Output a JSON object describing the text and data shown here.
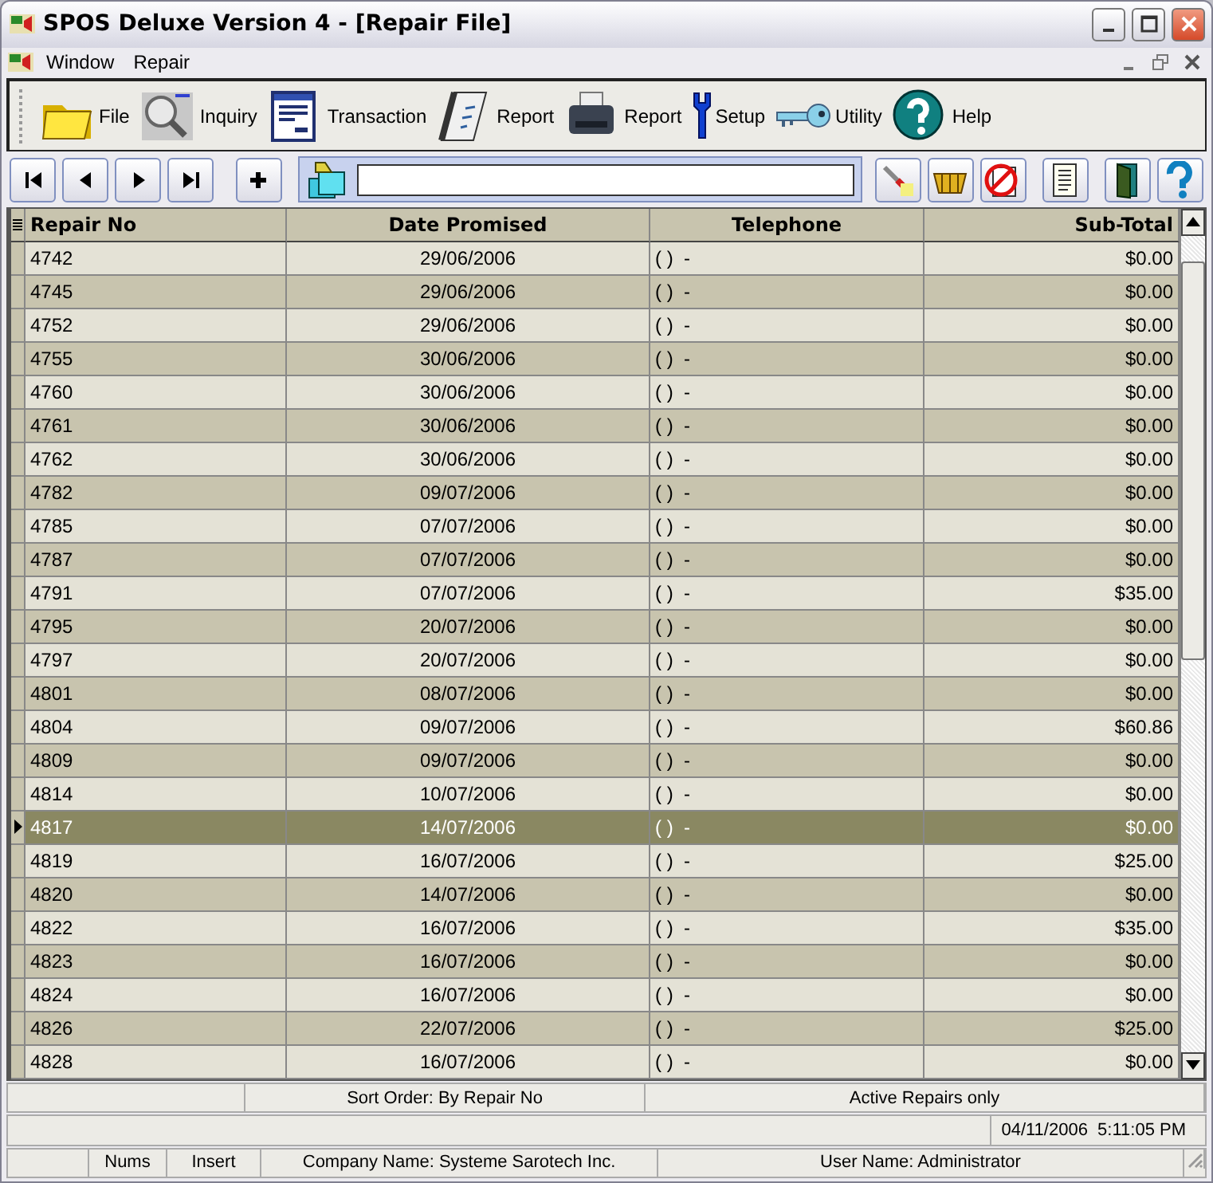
{
  "window": {
    "title": "SPOS Deluxe Version 4 - [Repair File]"
  },
  "menu": [
    "Window",
    "Repair"
  ],
  "toolbar": [
    {
      "kind": "folder",
      "label": "File"
    },
    {
      "kind": "magnifier",
      "label": "Inquiry"
    },
    {
      "kind": "form",
      "label": "Transaction"
    },
    {
      "kind": "notebook",
      "label": "Report"
    },
    {
      "kind": "printer",
      "label": "Report"
    },
    {
      "kind": "wrench",
      "label": "Setup"
    },
    {
      "kind": "key",
      "label": "Utility"
    },
    {
      "kind": "help",
      "label": "Help"
    }
  ],
  "table": {
    "columns": [
      "Repair No",
      "Date Promised",
      "Telephone",
      "Sub-Total"
    ],
    "rows": [
      {
        "cells": [
          "4742",
          "29/06/2006",
          "( )  -",
          "$0.00"
        ],
        "selected": false
      },
      {
        "cells": [
          "4745",
          "29/06/2006",
          "( )  -",
          "$0.00"
        ],
        "selected": false
      },
      {
        "cells": [
          "4752",
          "29/06/2006",
          "( )  -",
          "$0.00"
        ],
        "selected": false
      },
      {
        "cells": [
          "4755",
          "30/06/2006",
          "( )  -",
          "$0.00"
        ],
        "selected": false
      },
      {
        "cells": [
          "4760",
          "30/06/2006",
          "( )  -",
          "$0.00"
        ],
        "selected": false
      },
      {
        "cells": [
          "4761",
          "30/06/2006",
          "( )  -",
          "$0.00"
        ],
        "selected": false
      },
      {
        "cells": [
          "4762",
          "30/06/2006",
          "( )  -",
          "$0.00"
        ],
        "selected": false
      },
      {
        "cells": [
          "4782",
          "09/07/2006",
          "( )  -",
          "$0.00"
        ],
        "selected": false
      },
      {
        "cells": [
          "4785",
          "07/07/2006",
          "( )  -",
          "$0.00"
        ],
        "selected": false
      },
      {
        "cells": [
          "4787",
          "07/07/2006",
          "( )  -",
          "$0.00"
        ],
        "selected": false
      },
      {
        "cells": [
          "4791",
          "07/07/2006",
          "( )  -",
          "$35.00"
        ],
        "selected": false
      },
      {
        "cells": [
          "4795",
          "20/07/2006",
          "( )  -",
          "$0.00"
        ],
        "selected": false
      },
      {
        "cells": [
          "4797",
          "20/07/2006",
          "( )  -",
          "$0.00"
        ],
        "selected": false
      },
      {
        "cells": [
          "4801",
          "08/07/2006",
          "( )  -",
          "$0.00"
        ],
        "selected": false
      },
      {
        "cells": [
          "4804",
          "09/07/2006",
          "( )  -",
          "$60.86"
        ],
        "selected": false
      },
      {
        "cells": [
          "4809",
          "09/07/2006",
          "( )  -",
          "$0.00"
        ],
        "selected": false
      },
      {
        "cells": [
          "4814",
          "10/07/2006",
          "( )  -",
          "$0.00"
        ],
        "selected": false
      },
      {
        "cells": [
          "4817",
          "14/07/2006",
          "( )  -",
          "$0.00"
        ],
        "selected": true
      },
      {
        "cells": [
          "4819",
          "16/07/2006",
          "( )  -",
          "$25.00"
        ],
        "selected": false
      },
      {
        "cells": [
          "4820",
          "14/07/2006",
          "( )  -",
          "$0.00"
        ],
        "selected": false
      },
      {
        "cells": [
          "4822",
          "16/07/2006",
          "( )  -",
          "$35.00"
        ],
        "selected": false
      },
      {
        "cells": [
          "4823",
          "16/07/2006",
          "( )  -",
          "$0.00"
        ],
        "selected": false
      },
      {
        "cells": [
          "4824",
          "16/07/2006",
          "( )  -",
          "$0.00"
        ],
        "selected": false
      },
      {
        "cells": [
          "4826",
          "22/07/2006",
          "( )  -",
          "$25.00"
        ],
        "selected": false
      },
      {
        "cells": [
          "4828",
          "16/07/2006",
          "( )  -",
          "$0.00"
        ],
        "selected": false
      }
    ]
  },
  "status_bars": [
    {
      "kind": "split",
      "panes": [
        "Sort Order: By Repair No",
        "Active Repairs only"
      ]
    },
    {
      "kind": "clock",
      "panes": [
        "04/11/2006  5:11:05 PM"
      ]
    },
    {
      "kind": "info",
      "panes": [
        "Nums",
        "Insert",
        "Company Name: Systeme Sarotech Inc.",
        "User Name: Administrator"
      ]
    }
  ]
}
